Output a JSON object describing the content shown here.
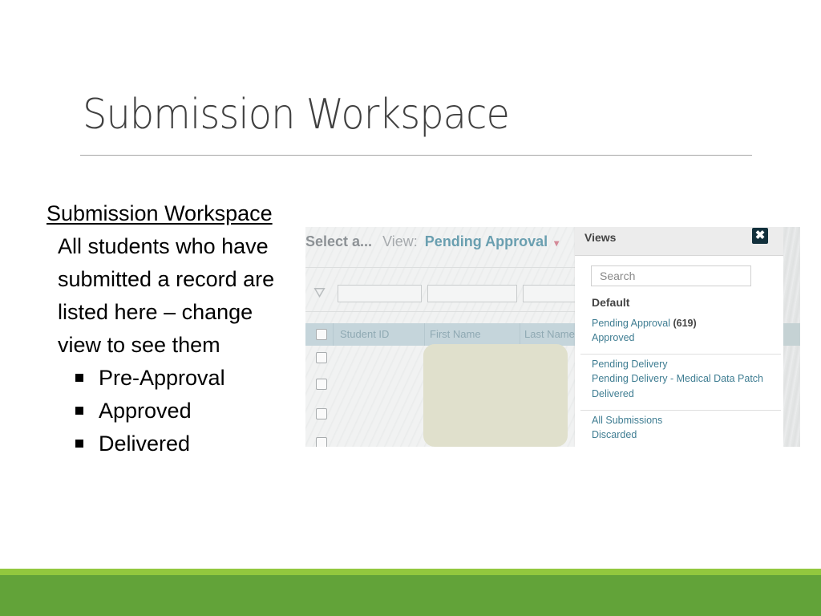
{
  "slide": {
    "title": "Submission Workspace",
    "heading": "Submission Workspace",
    "paragraph": "All students who have submitted a record are listed here – change view to see them",
    "bullets": [
      "Pre-Approval",
      "Approved",
      "Delivered"
    ]
  },
  "screenshot": {
    "toolbar": {
      "select_label": "Select a...",
      "view_label": "View:",
      "view_value": "Pending Approval",
      "caret": "▾"
    },
    "filter_icon": "⛛",
    "grid_headers": [
      "Student ID",
      "First Name",
      "Last Name"
    ],
    "views_panel": {
      "title": "Views",
      "close": "✖",
      "search_placeholder": "Search",
      "section_title": "Default",
      "group1": [
        {
          "label": "Pending Approval",
          "count": "(619)"
        },
        {
          "label": "Approved"
        }
      ],
      "group2": [
        {
          "label": "Pending Delivery"
        },
        {
          "label": "Pending Delivery - Medical Data Patch"
        },
        {
          "label": "Delivered"
        }
      ],
      "group3": [
        {
          "label": "All Submissions"
        },
        {
          "label": "Discarded"
        }
      ]
    }
  },
  "colors": {
    "footer_light": "#92c83e",
    "footer_dark": "#62a339",
    "link": "#3f7d92"
  }
}
